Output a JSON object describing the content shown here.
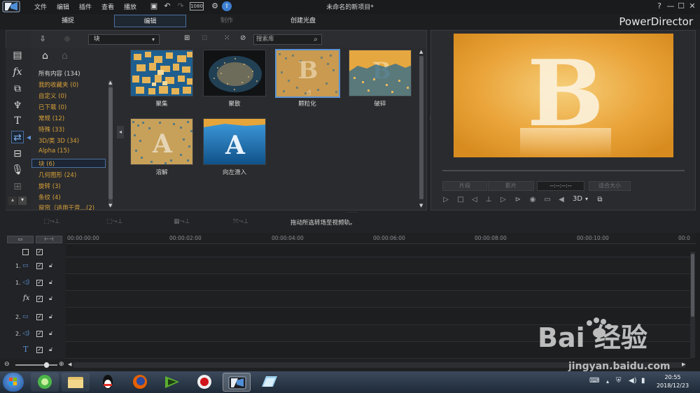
{
  "window": {
    "title": "未命名的新项目*",
    "brand": "PowerDirector",
    "help": "?",
    "minimize": "—",
    "maximize": "☐",
    "close": "✕"
  },
  "menu": [
    "文件",
    "编辑",
    "插件",
    "查看",
    "播放"
  ],
  "toolbar_extra": {
    "res_badge": "1080"
  },
  "modes": {
    "capture": "捕捉",
    "edit": "编辑",
    "produce": "制作",
    "disc": "创建光盘"
  },
  "library": {
    "dropdown_value": "块",
    "search_placeholder": "搜索库",
    "categories": [
      "所有内容 (134)",
      "我的收藏夹 (0)",
      "自定义 (0)",
      "已下载 (0)",
      "常规 (12)",
      "特殊 (33)",
      "3D/类 3D (34)",
      "Alpha (15)",
      "块 (6)",
      "几何图形 (24)",
      "旋转 (3)",
      "条纹 (4)",
      "窗帘（适用于音…(2)"
    ],
    "selected_category": "块 (6)",
    "items": [
      {
        "label": "聚集"
      },
      {
        "label": "聚散"
      },
      {
        "label": "颗粒化"
      },
      {
        "label": "破碎"
      },
      {
        "label": "溶解"
      },
      {
        "label": "向左滑入"
      }
    ],
    "selected_item": "颗粒化"
  },
  "preview": {
    "letter": "B",
    "btn_clip": "片段",
    "btn_movie": "影片",
    "timecode": "--:--:--:--",
    "fit": "适合大小",
    "mode_3d": "3D"
  },
  "edit_toolbar": {
    "hint": "拖动所选转场至视频轨。"
  },
  "timeline": {
    "ticks": [
      "00:00:00:00",
      "00:00:02:00",
      "00:00:04:00",
      "00:00:06:00",
      "00:00:08:00",
      "00:00:10:00",
      "00:0"
    ],
    "tracks": [
      {
        "label": "1.",
        "type": "video"
      },
      {
        "label": "1.",
        "type": "audio"
      },
      {
        "label": "fx",
        "type": "effect"
      },
      {
        "label": "2.",
        "type": "video"
      },
      {
        "label": "2.",
        "type": "audio"
      },
      {
        "label": "T",
        "type": "title"
      }
    ]
  },
  "taskbar": {
    "time": "20:55",
    "date": "2018/12/23"
  },
  "watermark": {
    "text": "Bai 经验",
    "url": "jingyan.baidu.com"
  },
  "colors": {
    "accent": "#5b93d6",
    "category": "#d9a23a",
    "gold": "#e8a93a"
  }
}
